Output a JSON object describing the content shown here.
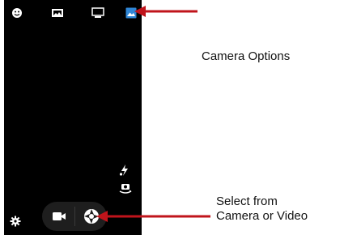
{
  "screen": {
    "top_bar": {
      "icons": [
        "face-mode-icon",
        "panorama-icon",
        "picture-size-icon",
        "gallery-icon"
      ],
      "highlight_color": "#2f86d6"
    },
    "side_controls": {
      "icons": [
        "flash-icon",
        "switch-camera-icon"
      ]
    },
    "bottom_bar": {
      "icons": [
        "settings-gear-icon",
        "video-camera-icon",
        "shutter-icon"
      ]
    }
  },
  "annotations": {
    "top_label": "Camera Options",
    "bottom_label_line1": "Select from",
    "bottom_label_line2": "Camera or Video",
    "arrow_color": "#c0141b"
  }
}
